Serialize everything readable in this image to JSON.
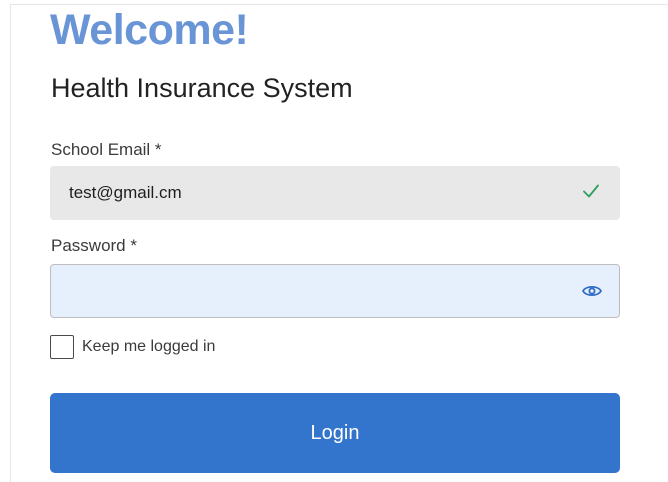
{
  "header": {
    "welcome": "Welcome!",
    "subtitle": "Health Insurance System"
  },
  "form": {
    "email": {
      "label": "School Email *",
      "value": "test@gmail.cm",
      "status_icon": "check-icon",
      "status_color": "#2e9e5b"
    },
    "password": {
      "label": "Password *",
      "value": "",
      "toggle_icon": "eye-icon"
    },
    "remember": {
      "label": "Keep me logged in",
      "checked": false
    },
    "submit_label": "Login"
  },
  "colors": {
    "accent": "#3374cd",
    "welcome": "#6994d6",
    "email_field_bg": "#e8e8e8",
    "password_field_bg": "#e6effc"
  }
}
